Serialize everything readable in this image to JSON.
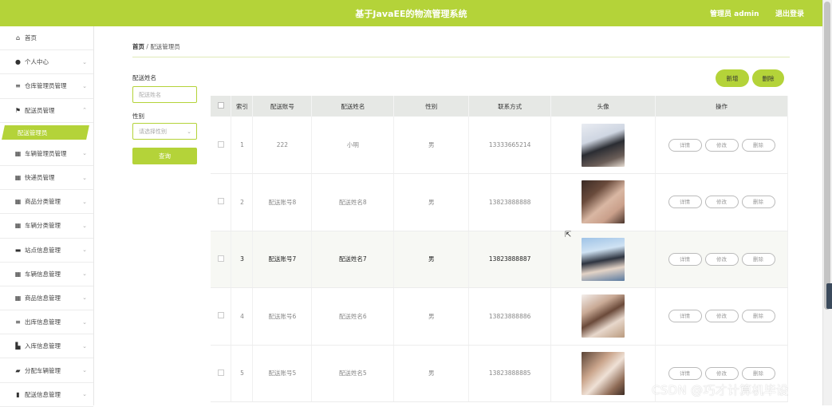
{
  "header": {
    "title": "基于JavaEE的物流管理系统",
    "admin_label": "管理员 admin",
    "logout_label": "退出登录",
    "brand_color": "#b4d339"
  },
  "sidebar": {
    "items": [
      {
        "label": "首页",
        "icon": "home-icon"
      },
      {
        "label": "个人中心",
        "icon": "user-icon"
      },
      {
        "label": "仓库管理员管理",
        "icon": "list-icon"
      },
      {
        "label": "配送员管理",
        "icon": "flag-icon"
      },
      {
        "label": "车辆管理员管理",
        "icon": "grid-icon"
      },
      {
        "label": "快递员管理",
        "icon": "grid-icon"
      },
      {
        "label": "商品分类管理",
        "icon": "grid-icon"
      },
      {
        "label": "车辆分类管理",
        "icon": "grid-icon"
      },
      {
        "label": "站点信息管理",
        "icon": "lock-icon"
      },
      {
        "label": "车辆信息管理",
        "icon": "grid-icon"
      },
      {
        "label": "商品信息管理",
        "icon": "grid-icon"
      },
      {
        "label": "出库信息管理",
        "icon": "list-icon"
      },
      {
        "label": "入库信息管理",
        "icon": "chart-icon"
      },
      {
        "label": "分配车辆管理",
        "icon": "truck-icon"
      },
      {
        "label": "配送信息管理",
        "icon": "book-icon"
      }
    ],
    "active_sub": "配送管理员"
  },
  "breadcrumb": {
    "home": "首页",
    "separator": "/",
    "current": "配送管理员"
  },
  "filters": {
    "name_label": "配送姓名",
    "name_placeholder": "配送姓名",
    "gender_label": "性别",
    "gender_placeholder": "请选择性别",
    "query_label": "查询"
  },
  "actions": {
    "add_label": "新增",
    "delete_label": "删除"
  },
  "table": {
    "headers": [
      "索引",
      "配送账号",
      "配送姓名",
      "性别",
      "联系方式",
      "头像",
      "操作"
    ],
    "op_labels": {
      "detail": "详情",
      "edit": "修改",
      "delete": "删除"
    },
    "rows": [
      {
        "index": "1",
        "account": "222",
        "name": "小明",
        "gender": "男",
        "phone": "13333665214"
      },
      {
        "index": "2",
        "account": "配送账号8",
        "name": "配送姓名8",
        "gender": "男",
        "phone": "13823888888"
      },
      {
        "index": "3",
        "account": "配送账号7",
        "name": "配送姓名7",
        "gender": "男",
        "phone": "13823888887"
      },
      {
        "index": "4",
        "account": "配送账号6",
        "name": "配送姓名6",
        "gender": "男",
        "phone": "13823888886"
      },
      {
        "index": "5",
        "account": "配送账号5",
        "name": "配送姓名5",
        "gender": "男",
        "phone": "13823888885"
      }
    ]
  },
  "watermark": "CSDN @巧才计算机毕设"
}
